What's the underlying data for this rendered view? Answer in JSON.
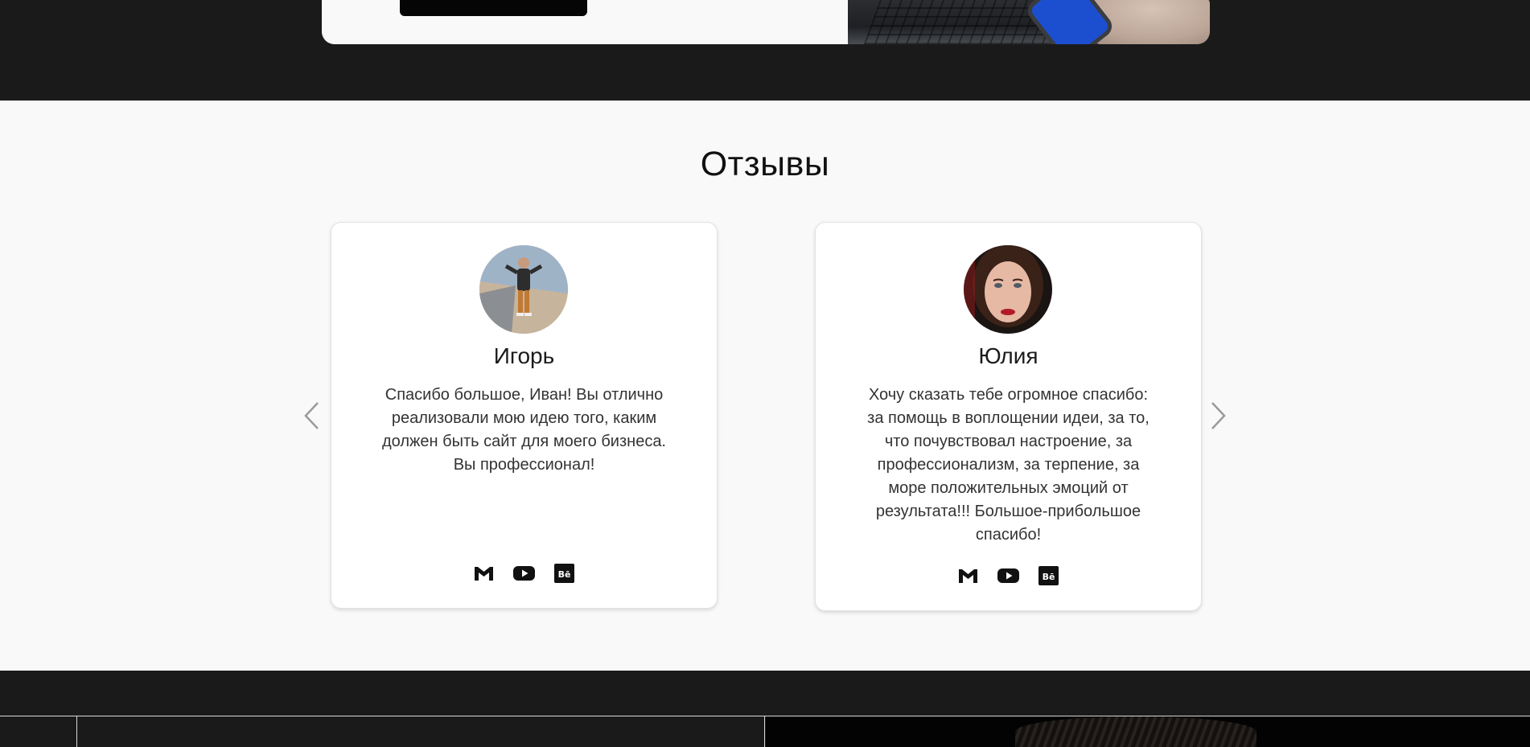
{
  "reviews": {
    "title": "Отзывы",
    "items": [
      {
        "name": "Игорь",
        "text": "Спасибо большое, Иван! Вы отлично реализовали мою идею того, каким должен быть сайт для моего бизнеса. Вы профессионал!",
        "social": [
          "gmail-icon",
          "youtube-icon",
          "behance-icon"
        ]
      },
      {
        "name": "Юлия",
        "text": "Хочу сказать тебе огромное спасибо: за помощь в воплощении идеи, за то, что почувствовал настроение, за профессионализм, за терпение, за море положительных эмоций от результата!!! Большое-прибольшое спасибо!",
        "social": [
          "gmail-icon",
          "youtube-icon",
          "behance-icon"
        ]
      }
    ],
    "prev_icon": "chevron-left-icon",
    "next_icon": "chevron-right-icon"
  },
  "colors": {
    "dark_band": "#1a1a1a",
    "section_bg": "#f9f9f9",
    "card_bg": "#ffffff",
    "text_dark": "#111111",
    "arrow": "#9a9a9a"
  }
}
